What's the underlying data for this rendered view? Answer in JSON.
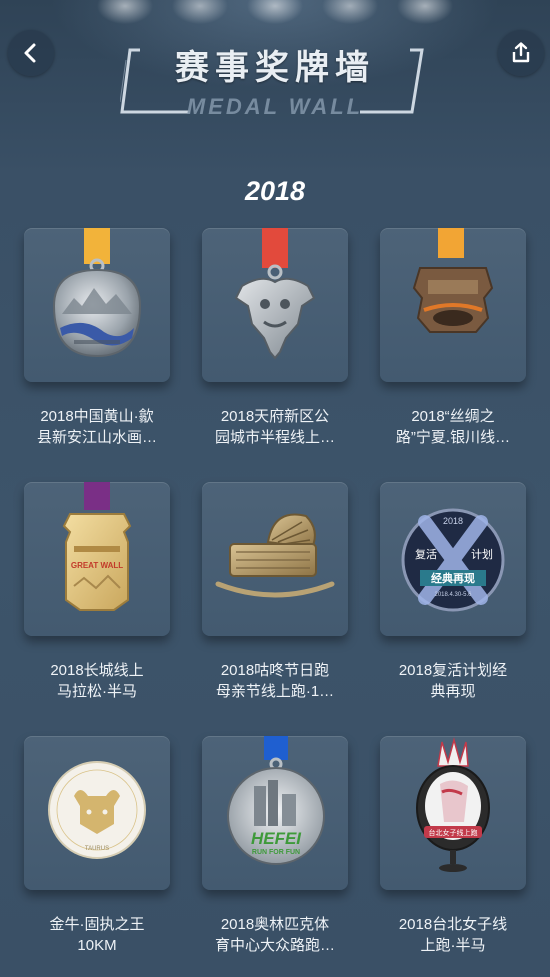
{
  "header": {
    "title_cn": "赛事奖牌墙",
    "title_en": "MEDAL WALL",
    "back_icon": "chevron-left-icon",
    "share_icon": "share-icon"
  },
  "year": "2018",
  "medals": [
    {
      "line1": "2018中国黄山·歙",
      "line2": "县新安江山水画…",
      "ribbon": "#f2b33a"
    },
    {
      "line1": "2018天府新区公",
      "line2": "园城市半程线上…",
      "ribbon": "#e24a3c"
    },
    {
      "line1": "2018“丝绸之",
      "line2": "路”宁夏.银川线…",
      "ribbon": "#f2a534"
    },
    {
      "line1": "2018长城线上",
      "line2": "马拉松·半马",
      "ribbon": "#7a2f86"
    },
    {
      "line1": "2018咕咚节日跑",
      "line2": "母亲节线上跑·1…",
      "ribbon": ""
    },
    {
      "line1": "2018复活计划经",
      "line2": "典再现",
      "ribbon": ""
    },
    {
      "line1": "金牛·固执之王",
      "line2": "10KM",
      "ribbon": ""
    },
    {
      "line1": "2018奥林匹克体",
      "line2": "育中心大众路跑…",
      "ribbon": "#1f5fd0"
    },
    {
      "line1": "2018台北女子线",
      "line2": "上跑·半马",
      "ribbon": ""
    }
  ],
  "medal_texts": {
    "resurrection_top": "2018",
    "resurrection_left": "复活",
    "resurrection_right": "计划",
    "resurrection_banner": "经典再现",
    "resurrection_date": "2018.4.30-5.6",
    "taurus": "TAURUS",
    "hefei": "HEFEI",
    "run_for_fun": "RUN FOR FUN",
    "taipei_banner": "台北女子线上跑",
    "greatwall": "GREAT WALL"
  }
}
